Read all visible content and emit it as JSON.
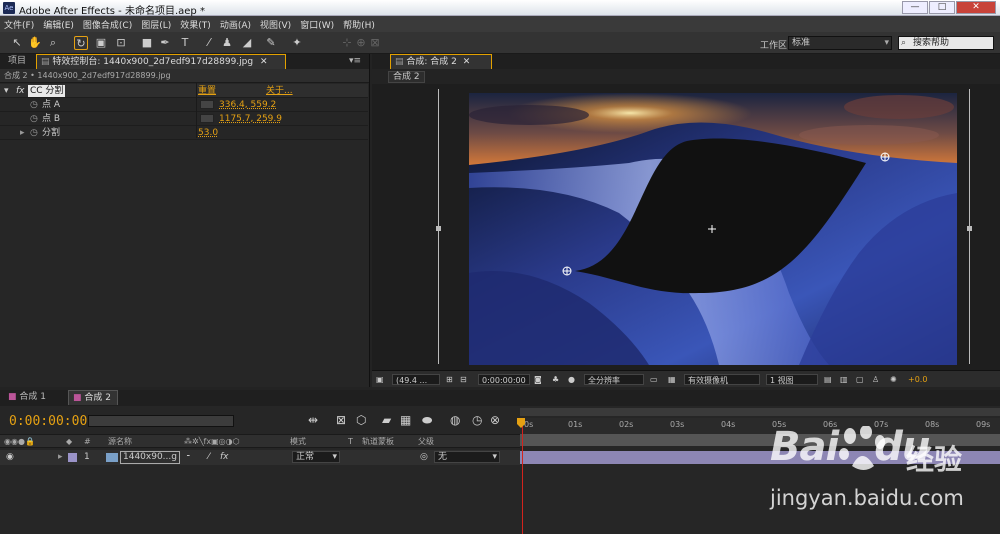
{
  "title_bar": {
    "app_icon": "Ae",
    "title": "Adobe After Effects - 未命名项目.aep *",
    "min": "—",
    "max": "□",
    "close": "✕"
  },
  "menu": [
    "文件(F)",
    "编辑(E)",
    "图像合成(C)",
    "图层(L)",
    "效果(T)",
    "动画(A)",
    "视图(V)",
    "窗口(W)",
    "帮助(H)"
  ],
  "toolbar": {
    "workspace_label": "工作区:",
    "workspace_value": "标准",
    "search_placeholder": "搜索帮助"
  },
  "left_panel": {
    "tab_project": "项目",
    "tab_effects": "特效控制台: 1440x900_2d7edf917d28899.jpg",
    "header": "合成 2 • 1440x900_2d7edf917d28899.jpg",
    "effect": {
      "fx": "fx",
      "name": "CC 分割",
      "reset": "重置",
      "about": "关于..."
    },
    "props": [
      {
        "label": "点 A",
        "value": "336.4, 559.2"
      },
      {
        "label": "点 B",
        "value": "1175.7, 259.9"
      },
      {
        "label": "分割",
        "value": "53.0"
      }
    ]
  },
  "comp_panel": {
    "tab": "合成: 合成 2",
    "subtab": "合成 2",
    "zoom": "(49.4 ...",
    "timecode": "0:00:00:00",
    "resolution": "全分辨率",
    "camera": "有效摄像机",
    "views": "1 视图",
    "exposure": "+0.0"
  },
  "timeline": {
    "tabs": [
      "合成 1",
      "合成 2"
    ],
    "timecode": "0:00:00:00",
    "columns": {
      "source": "源名称",
      "mode": "模式",
      "t": "T",
      "trkmat": "轨道蒙板",
      "parent": "父级"
    },
    "layer": {
      "num": "1",
      "name": "1440x90...g",
      "mode": "正常",
      "parent": "无"
    },
    "ruler": [
      "0s",
      "01s",
      "02s",
      "03s",
      "04s",
      "05s",
      "06s",
      "07s",
      "08s",
      "09s"
    ]
  },
  "watermark": {
    "logo": "Bai",
    "logo2": "du",
    "cn": "经验",
    "url": "jingyan.baidu.com"
  },
  "colors": {
    "accent": "#e5a113",
    "playhead": "#d3231d",
    "layer_bar": "#8d86b4"
  }
}
